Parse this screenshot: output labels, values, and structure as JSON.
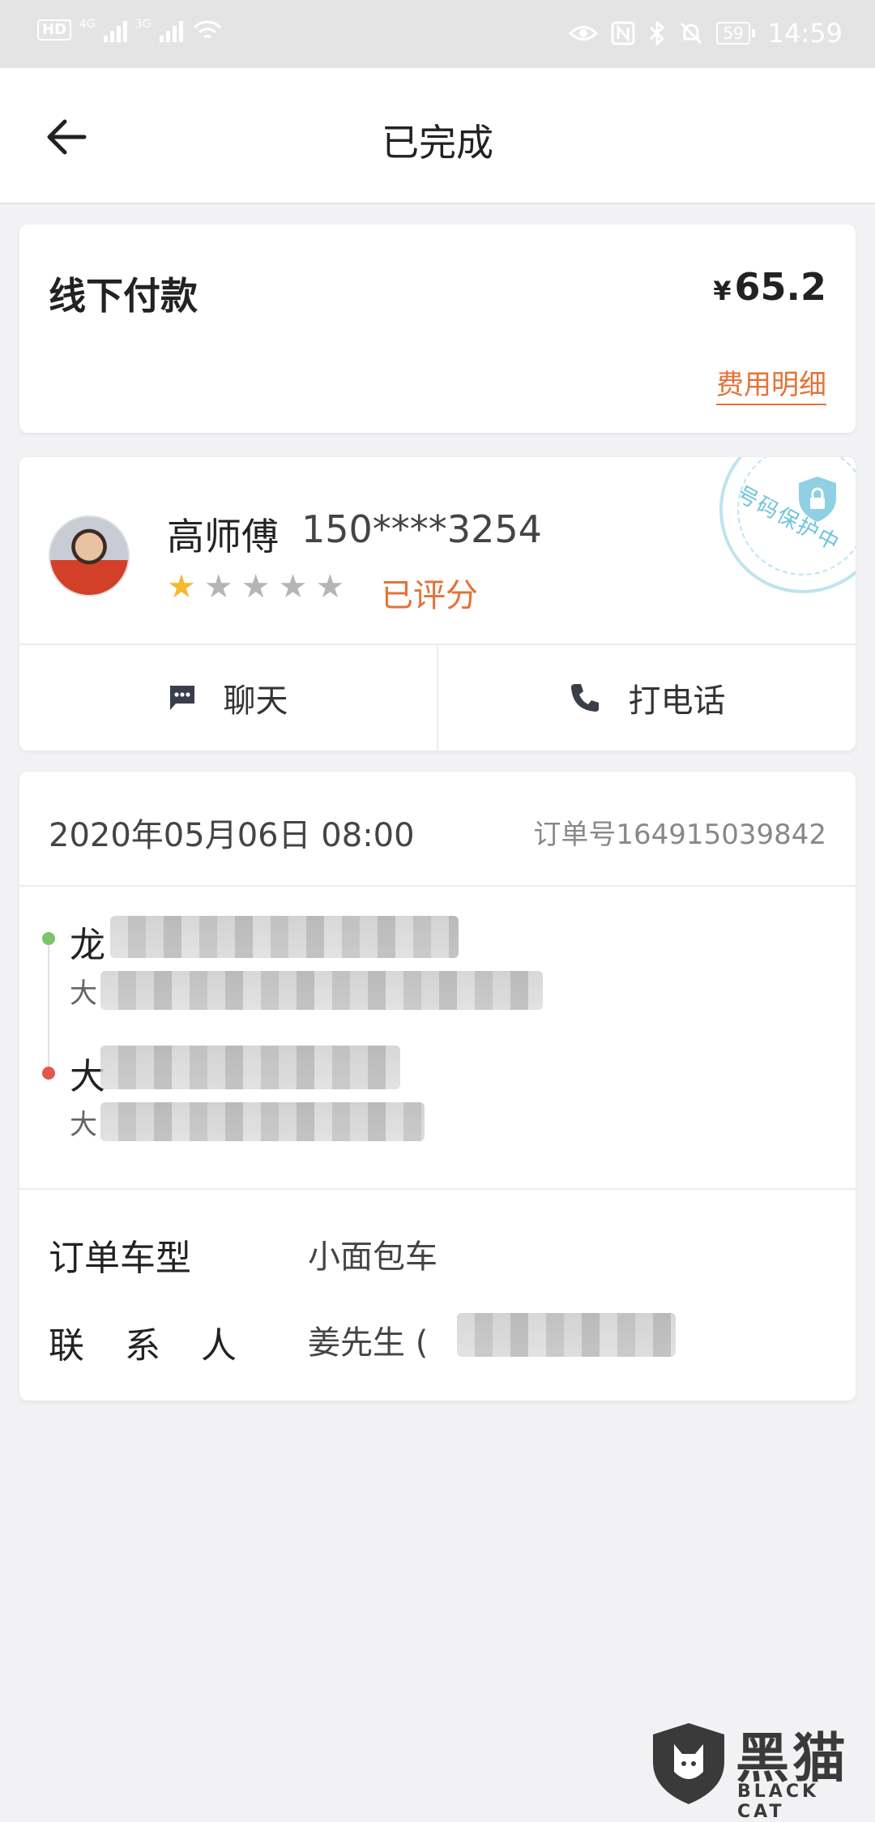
{
  "status_bar": {
    "hd": "HD",
    "net1": "4G",
    "net2": "3G",
    "battery": "59",
    "time": "14:59"
  },
  "header": {
    "title": "已完成"
  },
  "payment": {
    "label": "线下付款",
    "currency": "¥",
    "amount": "65.2",
    "fee_detail_link": "费用明细"
  },
  "driver": {
    "name": "高师傅",
    "phone": "150****3254",
    "rating": 1,
    "rating_max": 5,
    "rating_status": "已评分",
    "protection_badge": "号码保护中",
    "chat_label": "聊天",
    "call_label": "打电话"
  },
  "order": {
    "date": "2020年05月06日 08:00",
    "order_no": "订单号164915039842",
    "pickup_first_char": "龙",
    "pickup_sub_first_char": "大",
    "dropoff_first_char": "大",
    "dropoff_sub_first_char": "大",
    "vehicle_label": "订单车型",
    "vehicle_value": "小面包车",
    "contact_label": "联 系 人",
    "contact_value": "姜先生 ("
  },
  "watermark": {
    "text": "黑猫",
    "sub": "BLACK CAT"
  },
  "colors": {
    "accent": "#e37338",
    "star_on": "#f5b82e",
    "star_off": "#b5b5b5",
    "start_dot": "#7cc468",
    "end_dot": "#e2574c",
    "protect": "#6ec3dc"
  }
}
